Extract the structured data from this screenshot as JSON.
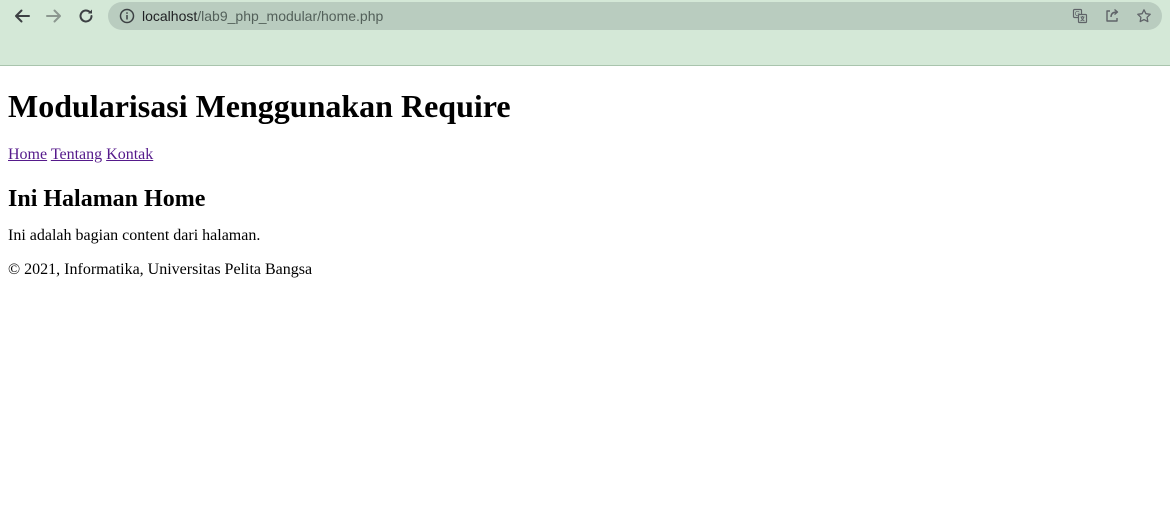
{
  "browser": {
    "url_host": "localhost",
    "url_path": "/lab9_php_modular/home.php",
    "icons": {
      "back": "arrow-left-icon",
      "forward": "arrow-right-icon",
      "reload": "reload-icon",
      "site_info": "info-circle-icon",
      "translate": "translate-icon",
      "share": "share-icon",
      "bookmark": "star-icon"
    },
    "colors": {
      "toolbar": "#d4e8d7",
      "omnibox": "#b9ccbf"
    }
  },
  "page": {
    "title": "Modularisasi Menggunakan Require",
    "nav": [
      {
        "label": "Home"
      },
      {
        "label": "Tentang"
      },
      {
        "label": "Kontak"
      }
    ],
    "heading": "Ini Halaman Home",
    "content": "Ini adalah bagian content dari halaman.",
    "footer": "© 2021, Informatika, Universitas Pelita Bangsa",
    "link_color": "#551a8b"
  }
}
